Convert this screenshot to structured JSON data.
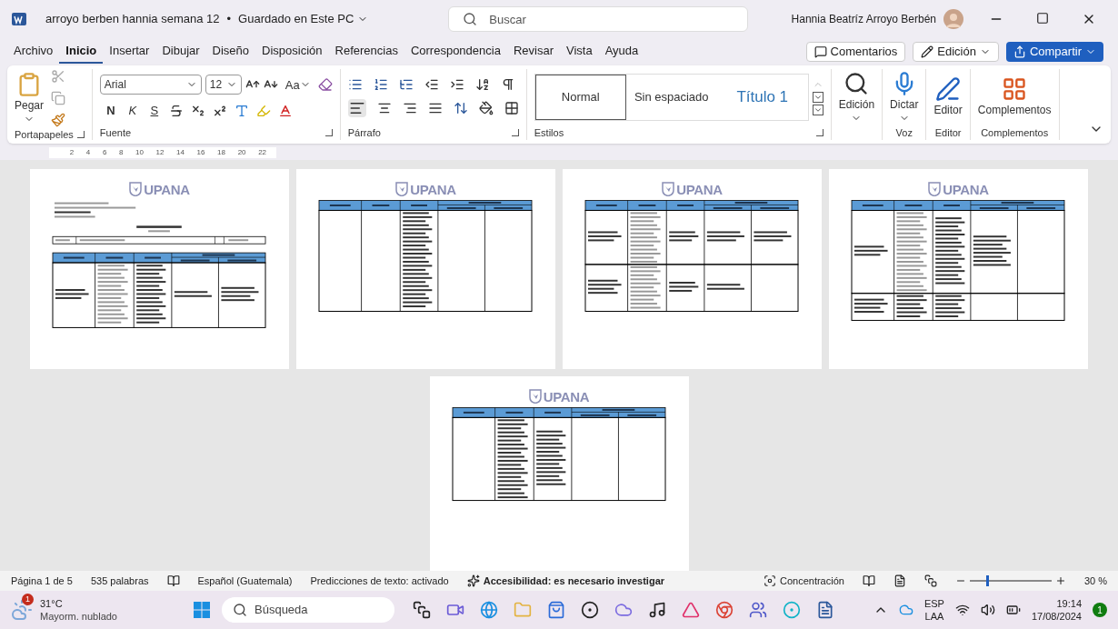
{
  "title_bar": {
    "document": "arroyo berben hannia semana 12",
    "separator": "•",
    "save_status": "Guardado en Este PC",
    "search_placeholder": "Buscar",
    "user": "Hannia Beatríz Arroyo  Berbén"
  },
  "menu_tabs": [
    {
      "label": "Archivo",
      "selected": false
    },
    {
      "label": "Inicio",
      "selected": true
    },
    {
      "label": "Insertar",
      "selected": false
    },
    {
      "label": "Dibujar",
      "selected": false
    },
    {
      "label": "Diseño",
      "selected": false
    },
    {
      "label": "Disposición",
      "selected": false
    },
    {
      "label": "Referencias",
      "selected": false
    },
    {
      "label": "Correspondencia",
      "selected": false
    },
    {
      "label": "Revisar",
      "selected": false
    },
    {
      "label": "Vista",
      "selected": false
    },
    {
      "label": "Ayuda",
      "selected": false
    }
  ],
  "menu_buttons": {
    "comments": "Comentarios",
    "editing": "Edición",
    "share": "Compartir"
  },
  "ribbon": {
    "paste": "Pegar",
    "clipboard_group": "Portapapeles",
    "font_name": "Arial",
    "font_size": "12",
    "case": "Aa",
    "bold": "N",
    "italic": "K",
    "underline": "S",
    "font_group": "Fuente",
    "paragraph_group": "Párrafo",
    "styles": [
      {
        "label": "Normal",
        "selected": true
      },
      {
        "label": "Sin espaciado",
        "selected": false
      },
      {
        "label": "Título 1",
        "selected": false
      }
    ],
    "styles_group": "Estilos",
    "find": "Edición",
    "dictate": "Dictar",
    "voice_group": "Voz",
    "editor": "Editor",
    "editor_group": "Editor",
    "addins": "Complementos",
    "addins_group": "Complementos"
  },
  "ruler": [
    "2",
    "4",
    "6",
    "8",
    "10",
    "12",
    "14",
    "16",
    "18",
    "20",
    "22"
  ],
  "pages": [
    {
      "logo": "UPANA",
      "kind": "cover"
    },
    {
      "logo": "UPANA",
      "kind": "table"
    },
    {
      "logo": "UPANA",
      "kind": "table"
    },
    {
      "logo": "UPANA",
      "kind": "table"
    },
    {
      "logo": "UPANA",
      "kind": "table"
    }
  ],
  "status_bar": {
    "page": "Página 1 de 5",
    "words": "535 palabras",
    "language": "Español (Guatemala)",
    "predictions": "Predicciones de texto: activado",
    "accessibility": "Accesibilidad: es necesario investigar",
    "focus": "Concentración",
    "zoom": "30 %",
    "level": 0.2
  },
  "taskbar": {
    "temperature": "31°C",
    "weather": "Mayorm. nublado",
    "weather_badge": "1",
    "search": "Búsqueda",
    "language": "ESP",
    "layout": "LAA",
    "time": "19:14",
    "date": "17/08/2024",
    "notifications": "1"
  }
}
